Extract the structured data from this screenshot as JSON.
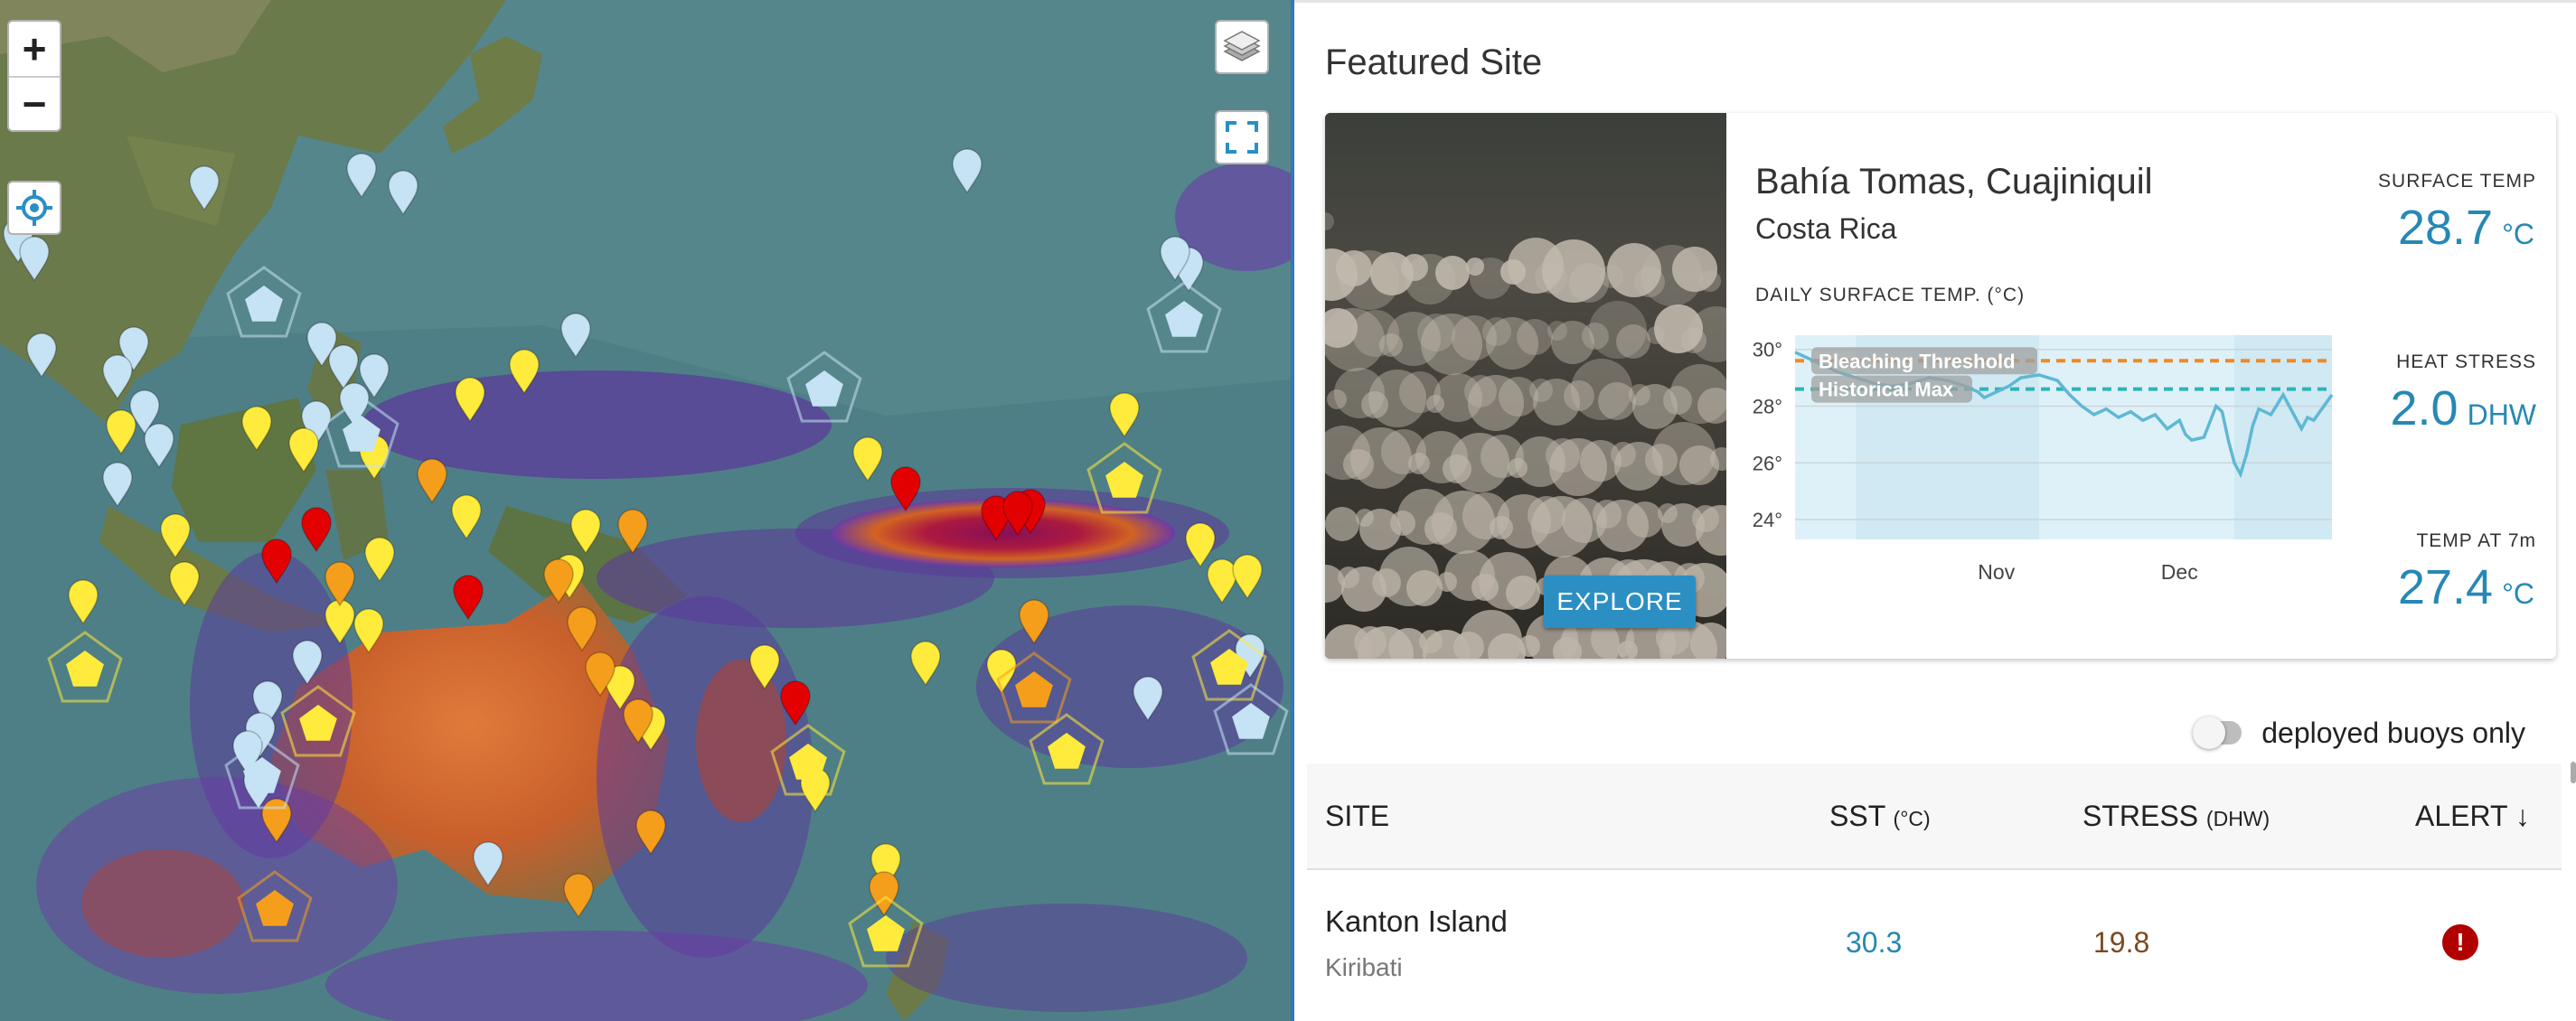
{
  "map": {
    "zoom_in": "+",
    "zoom_out": "−",
    "icons": [
      "plus-icon",
      "minus-icon",
      "locate-icon",
      "layers-icon",
      "fullscreen-icon",
      "map-pin-icon",
      "pentagon-marker-icon"
    ],
    "marker_colors": {
      "watch": "#c6e2f5",
      "warning": "#ffeb3b",
      "alert1": "#f59e1b",
      "alert2": "#e30000"
    }
  },
  "panel": {
    "title": "Featured Site",
    "site": {
      "name": "Bahía Tomas, Cuajiniquil",
      "country": "Costa Rica",
      "explore_label": "EXPLORE",
      "chart_label": "DAILY SURFACE TEMP. (°C)",
      "metrics": [
        {
          "label": "SURFACE TEMP",
          "value": "28.7",
          "unit": "°C"
        },
        {
          "label": "HEAT STRESS",
          "value": "2.0",
          "unit": "DHW"
        },
        {
          "label": "TEMP AT 7m",
          "value": "27.4",
          "unit": "°C"
        }
      ]
    },
    "toggle": {
      "label": "deployed buoys only",
      "on": false
    },
    "table": {
      "headers": {
        "site": "SITE",
        "sst": "SST",
        "sst_unit": "(°C)",
        "stress": "STRESS",
        "stress_unit": "(DHW)",
        "alert": "ALERT ↓"
      },
      "rows": [
        {
          "name": "Kanton Island",
          "country": "Kiribati",
          "sst": "30.3",
          "stress": "19.8",
          "alert": "!"
        }
      ]
    }
  },
  "chart_data": {
    "type": "line",
    "title": "DAILY SURFACE TEMP. (°C)",
    "ylim": [
      23.3,
      30.5
    ],
    "yticks": [
      30,
      28,
      26,
      24
    ],
    "ytick_labels": [
      "30°",
      "28°",
      "26°",
      "24°"
    ],
    "xtick_labels": [
      {
        "label": "Nov",
        "day": 33
      },
      {
        "label": "Dec",
        "day": 63
      }
    ],
    "x_days": 88,
    "thresholds": [
      {
        "name": "Bleaching Threshold",
        "value": 29.6,
        "color": "#f08a24"
      },
      {
        "name": "Historical Max",
        "value": 28.6,
        "color": "#2bb5b5"
      }
    ],
    "series": [
      {
        "color": "#5fb8d4",
        "values": [
          [
            0,
            29.9
          ],
          [
            3,
            29.6
          ],
          [
            7,
            29.2
          ],
          [
            10,
            29.0
          ],
          [
            13,
            28.8
          ],
          [
            16,
            28.7
          ],
          [
            19,
            28.8
          ],
          [
            22,
            29.0
          ],
          [
            25,
            28.9
          ],
          [
            28,
            28.7
          ],
          [
            30,
            28.5
          ],
          [
            31,
            28.3
          ],
          [
            33,
            28.5
          ],
          [
            35,
            28.7
          ],
          [
            37,
            29.0
          ],
          [
            40,
            29.1
          ],
          [
            43,
            28.9
          ],
          [
            45,
            28.4
          ],
          [
            47,
            28.0
          ],
          [
            49,
            27.7
          ],
          [
            51,
            27.9
          ],
          [
            53,
            27.6
          ],
          [
            55,
            27.8
          ],
          [
            57,
            27.5
          ],
          [
            59,
            27.7
          ],
          [
            61,
            27.2
          ],
          [
            63,
            27.5
          ],
          [
            64,
            27.0
          ],
          [
            65,
            26.8
          ],
          [
            67,
            26.9
          ],
          [
            69,
            28.0
          ],
          [
            70,
            27.8
          ],
          [
            71,
            26.8
          ],
          [
            72,
            26.0
          ],
          [
            73,
            25.6
          ],
          [
            74,
            26.3
          ],
          [
            75,
            27.3
          ],
          [
            76,
            27.9
          ],
          [
            78,
            27.7
          ],
          [
            80,
            28.4
          ],
          [
            82,
            27.6
          ],
          [
            83,
            27.2
          ],
          [
            84,
            27.6
          ],
          [
            85,
            27.5
          ],
          [
            86,
            27.8
          ],
          [
            87,
            28.1
          ],
          [
            88,
            28.4
          ]
        ]
      }
    ]
  }
}
